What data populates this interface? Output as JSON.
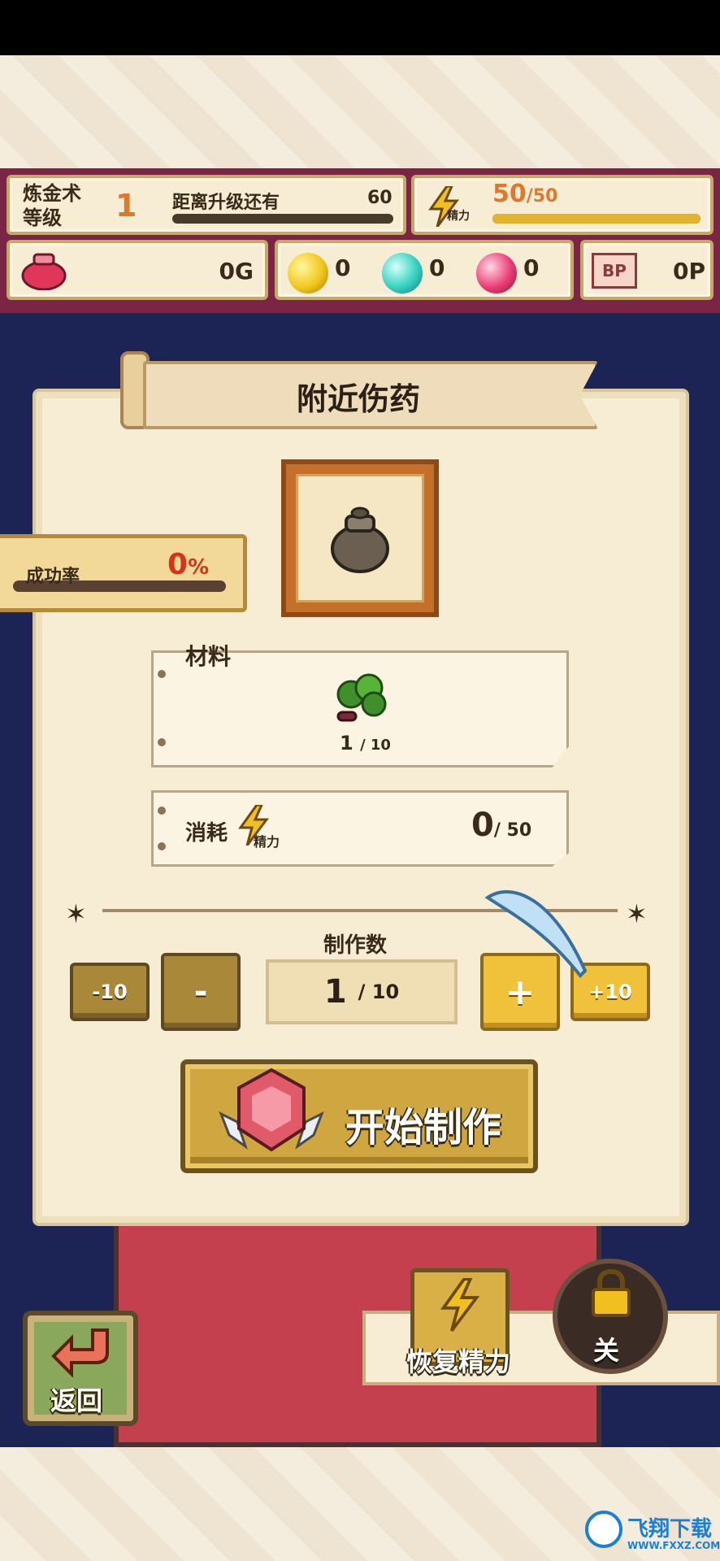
{
  "hud": {
    "alchemy_label_line1": "炼金术",
    "alchemy_label_line2": "等级",
    "level": "1",
    "next_level_label": "距离升级还有",
    "next_level_value": "60",
    "energy_value": "50",
    "energy_max": "/50",
    "energy_label": "精力",
    "gold": "0G",
    "gem_yellow": "0",
    "gem_cyan": "0",
    "gem_pink": "0",
    "bp_icon_text": "BP",
    "bp": "0P"
  },
  "recipe": {
    "title": "附近伤药",
    "success_label": "成功率",
    "success_value": "0",
    "success_unit": "%"
  },
  "materials": {
    "label": "材料",
    "count": "1",
    "need": "/ 10"
  },
  "consume": {
    "label": "消耗",
    "energy_label": "精力",
    "value": "0",
    "max": "/ 50"
  },
  "craft": {
    "count_label": "制作数",
    "minus10": "-10",
    "minus": "-",
    "plus": "+",
    "plus10": "+10",
    "count": "1",
    "count_max": "/ 10",
    "start": "开始制作"
  },
  "bottom": {
    "back": "返回",
    "restore": "恢复精力",
    "close": "关"
  },
  "watermark": {
    "name": "飞翔下载",
    "url": "WWW.FXXZ.COM"
  },
  "colors": {
    "hud_bg": "#7a2446",
    "backdrop": "#1c2455",
    "accent_gold": "#e3b32e",
    "danger": "#d1361c"
  }
}
